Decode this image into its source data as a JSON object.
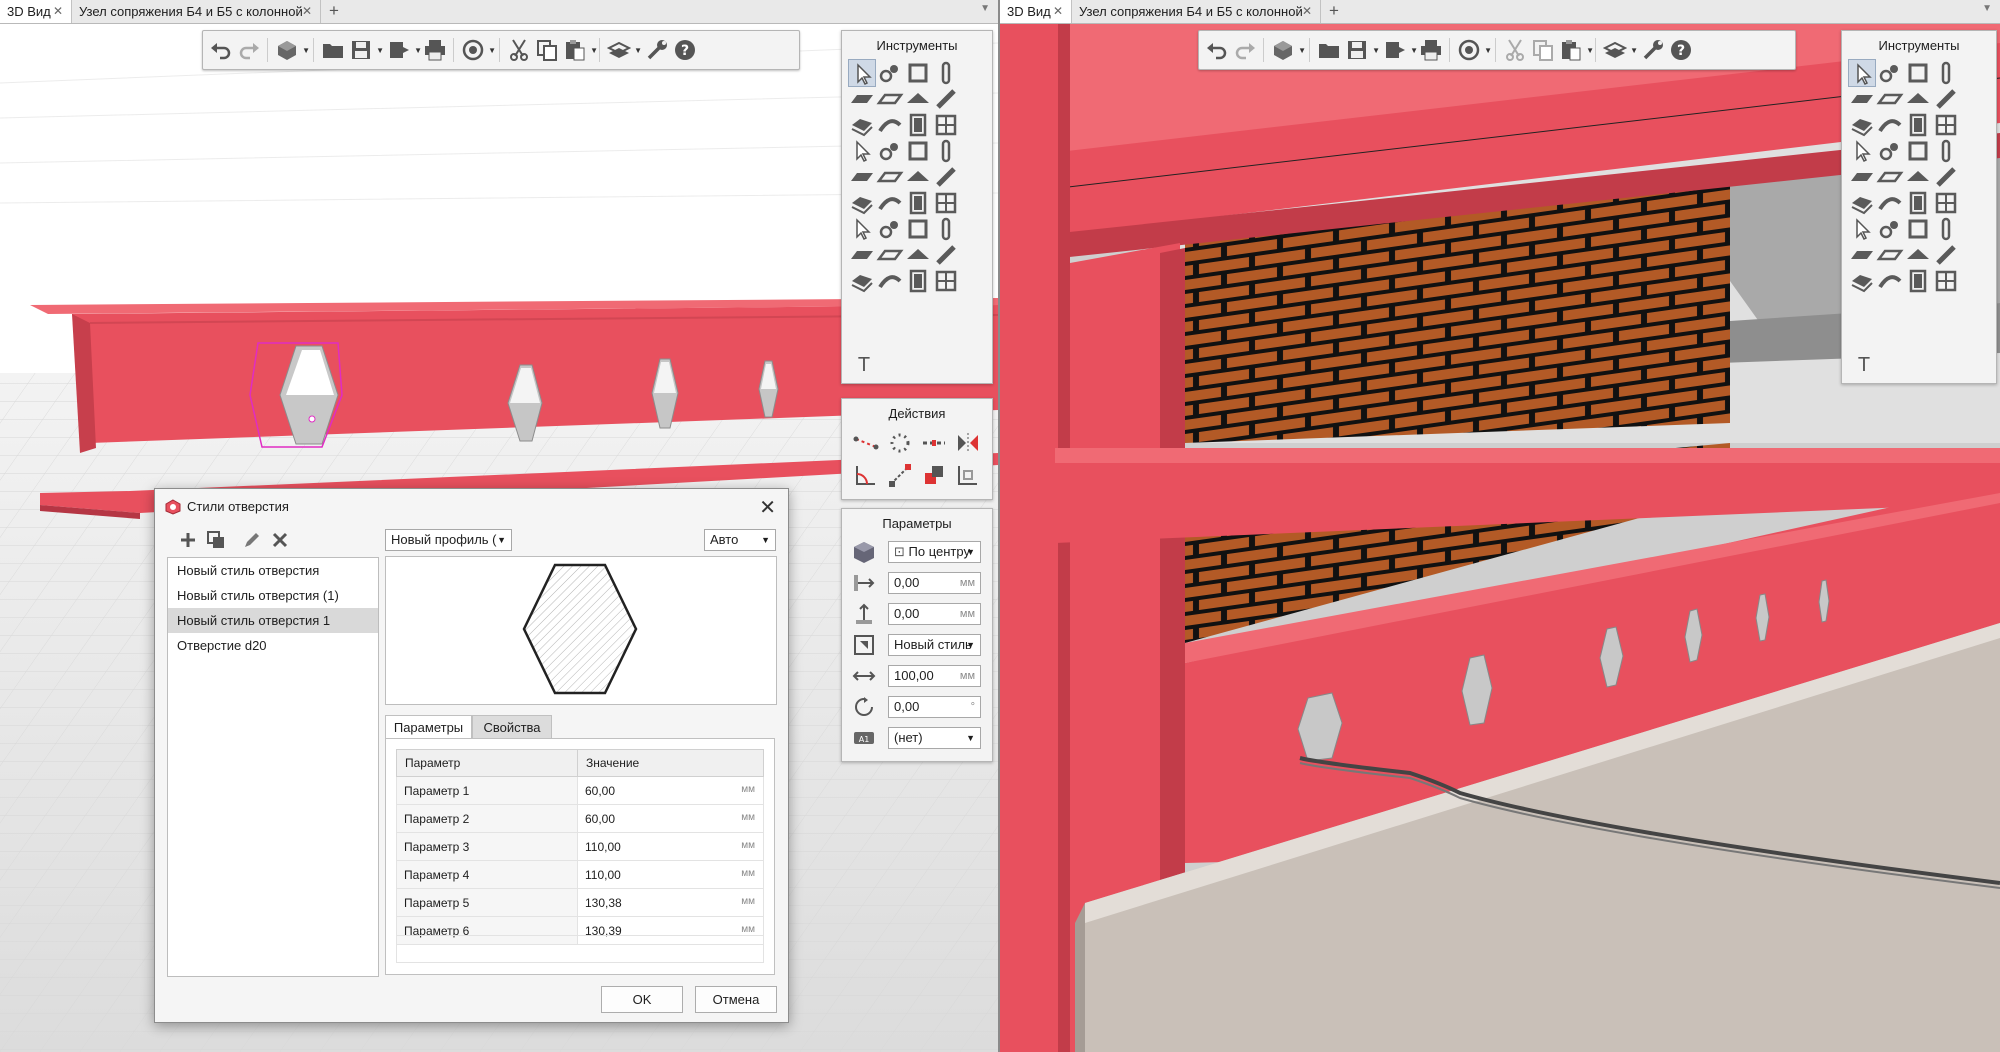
{
  "left": {
    "tabs": [
      {
        "label": "3D Вид",
        "active": true
      },
      {
        "label": "Узел сопряжения Б4 и Б5 с колонной",
        "active": false
      }
    ]
  },
  "right": {
    "tabs": [
      {
        "label": "3D Вид",
        "active": true
      },
      {
        "label": "Узел сопряжения Б4 и Б5 с колонной",
        "active": false
      }
    ]
  },
  "toolbar": {
    "icons": [
      "undo-icon",
      "redo-icon",
      "view-cube-icon",
      "open-folder-icon",
      "save-icon",
      "export-icon",
      "print-icon",
      "orbit-icon",
      "cut-icon",
      "copy-icon",
      "paste-icon",
      "layers-icon",
      "wrench-icon",
      "help-icon"
    ]
  },
  "panels": {
    "tools_title": "Инструменты",
    "actions_title": "Действия",
    "params_title": "Параметры",
    "text_tool": "T",
    "params": {
      "anchor": "По центру",
      "offset_x": "0,00",
      "offset_y": "0,00",
      "style": "Новый стиль",
      "length": "100,00",
      "angle": "0,00",
      "layer": "(нет)",
      "unit_mm": "мм",
      "unit_deg": "°"
    }
  },
  "dialog": {
    "title": "Стили отверстия",
    "styles": [
      "Новый стиль отверстия",
      "Новый стиль отверстия (1)",
      "Новый стиль отверстия 1",
      "Отверстие d20"
    ],
    "selected_index": 2,
    "profile_combo": "Новый профиль (",
    "auto_combo": "Авто",
    "tab_params": "Параметры",
    "tab_props": "Свойства",
    "col_param": "Параметр",
    "col_value": "Значение",
    "unit": "мм",
    "rows": [
      {
        "name": "Параметр 1",
        "value": "60,00"
      },
      {
        "name": "Параметр 2",
        "value": "60,00"
      },
      {
        "name": "Параметр 3",
        "value": "110,00"
      },
      {
        "name": "Параметр 4",
        "value": "110,00"
      },
      {
        "name": "Параметр 5",
        "value": "130,38"
      },
      {
        "name": "Параметр 6",
        "value": "130,39"
      }
    ],
    "ok": "OK",
    "cancel": "Отмена"
  },
  "colors": {
    "steel_red": "#e8505e",
    "brick": "#b35a26",
    "floor": "#c9c0b8"
  }
}
